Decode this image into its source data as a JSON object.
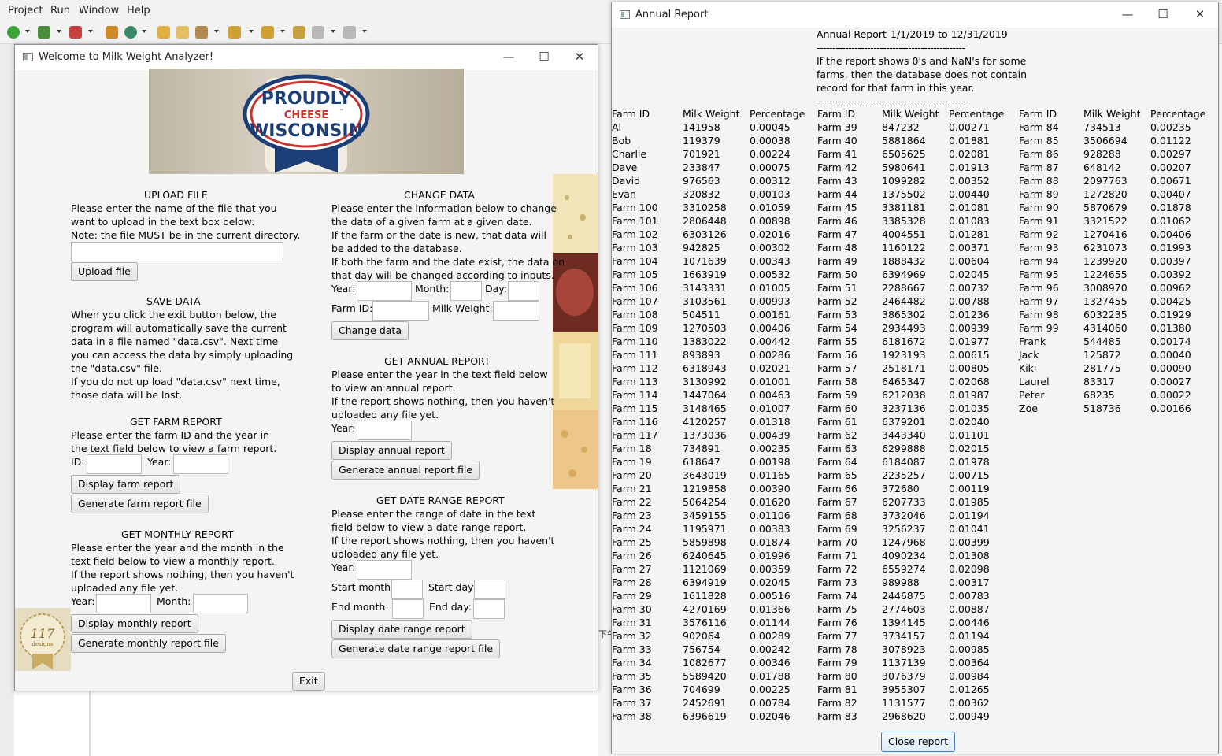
{
  "ide": {
    "menu": [
      "Project",
      "Run",
      "Window",
      "Help"
    ],
    "hint": "下午"
  },
  "main_window": {
    "title": "Welcome to Milk Weight Analyzer!",
    "controls": {
      "minimize": "—",
      "maximize": "☐",
      "close": "✕"
    },
    "banner": {
      "line1": "PROUDLY",
      "line2": "CHEESE",
      "line3": "WISCONSIN",
      "tm": "™"
    },
    "badge": {
      "number": "117",
      "text": "designs"
    },
    "upload": {
      "heading": "UPLOAD FILE",
      "lines": [
        "Please enter the name of the file that you",
        "want to upload in the text box below:",
        "Note: the file MUST be in the current directory."
      ],
      "button": "Upload file"
    },
    "save": {
      "heading": "SAVE DATA",
      "lines": [
        "When you click the exit button below, the",
        "program will automatically save the current",
        "data in a file named \"data.csv\". Next time",
        "you can access the data by simply uploading",
        "the \"data.csv\" file.",
        "If you do not up load \"data.csv\" next time,",
        "those data will be lost."
      ]
    },
    "farm_report": {
      "heading": "GET FARM REPORT",
      "lines": [
        "Please enter the farm ID and the year in",
        "the text field below to view a farm report."
      ],
      "id_label": "ID:",
      "year_label": "Year:",
      "display_button": "Display farm report",
      "generate_button": "Generate farm report file"
    },
    "monthly_report": {
      "heading": "GET MONTHLY REPORT",
      "lines": [
        "Please enter the year and the month in the",
        "text field below to view a monthly report.",
        "If the report shows nothing, then you haven't",
        "uploaded any file yet."
      ],
      "year_label": "Year:",
      "month_label": "Month:",
      "display_button": "Display monthly report",
      "generate_button": "Generate monthly report file"
    },
    "change_data": {
      "heading": "CHANGE DATA",
      "lines": [
        "Please enter the information below to change",
        "the data of a given farm at a given date.",
        "If the farm or the date is new, that data will",
        "be added to the database.",
        "If both the farm and the date exist, the data on",
        "that day will be changed according to inputs."
      ],
      "year_label": "Year:",
      "month_label": "Month:",
      "day_label": "Day:",
      "farm_id_label": "Farm ID:",
      "milk_weight_label": "Milk Weight:",
      "button": "Change data"
    },
    "annual_report": {
      "heading": "GET ANNUAL REPORT",
      "lines": [
        "Please enter the year in the text field below",
        "to view an annual report.",
        "If the report shows nothing, then you haven't",
        "uploaded any file yet."
      ],
      "year_label": "Year:",
      "display_button": "Display annual report",
      "generate_button": "Generate annual report file"
    },
    "date_range_report": {
      "heading": "GET DATE RANGE REPORT",
      "lines": [
        "Please enter the range of date in the text",
        "field below to view a date range report.",
        "If the report shows nothing, then you haven't",
        "uploaded any file yet."
      ],
      "year_label": "Year:",
      "start_month_label": "Start month:",
      "start_day_label": "Start day:",
      "end_month_label": "End month:",
      "end_day_label": "End day:",
      "display_button": "Display date range report",
      "generate_button": "Generate date range report file"
    },
    "exit_button": "Exit"
  },
  "report_window": {
    "title": "Annual Report",
    "controls": {
      "minimize": "—",
      "maximize": "☐",
      "close": "✕"
    },
    "header_title": "Annual Report",
    "header_range": "1/1/2019 to 12/31/2019",
    "separator": "-----------------------------------------------",
    "note": [
      "If the report shows 0's and NaN's for some",
      "farms, then the database does not contain",
      "record for that farm in this year."
    ],
    "columns": [
      "Farm ID",
      "Milk Weight",
      "Percentage"
    ],
    "col1": [
      [
        "Al",
        "141958",
        "0.00045"
      ],
      [
        "Bob",
        "119379",
        "0.00038"
      ],
      [
        "Charlie",
        "701921",
        "0.00224"
      ],
      [
        "Dave",
        "233847",
        "0.00075"
      ],
      [
        "David",
        "976563",
        "0.00312"
      ],
      [
        "Evan",
        "320832",
        "0.00103"
      ],
      [
        "Farm 100",
        "3310258",
        "0.01059"
      ],
      [
        "Farm 101",
        "2806448",
        "0.00898"
      ],
      [
        "Farm 102",
        "6303126",
        "0.02016"
      ],
      [
        "Farm 103",
        "942825",
        "0.00302"
      ],
      [
        "Farm 104",
        "1071639",
        "0.00343"
      ],
      [
        "Farm 105",
        "1663919",
        "0.00532"
      ],
      [
        "Farm 106",
        "3143331",
        "0.01005"
      ],
      [
        "Farm 107",
        "3103561",
        "0.00993"
      ],
      [
        "Farm 108",
        "504511",
        "0.00161"
      ],
      [
        "Farm 109",
        "1270503",
        "0.00406"
      ],
      [
        "Farm 110",
        "1383022",
        "0.00442"
      ],
      [
        "Farm 111",
        "893893",
        "0.00286"
      ],
      [
        "Farm 112",
        "6318943",
        "0.02021"
      ],
      [
        "Farm 113",
        "3130992",
        "0.01001"
      ],
      [
        "Farm 114",
        "1447064",
        "0.00463"
      ],
      [
        "Farm 115",
        "3148465",
        "0.01007"
      ],
      [
        "Farm 116",
        "4120257",
        "0.01318"
      ],
      [
        "Farm 117",
        "1373036",
        "0.00439"
      ],
      [
        "Farm 18",
        "734891",
        "0.00235"
      ],
      [
        "Farm 19",
        "618647",
        "0.00198"
      ],
      [
        "Farm 20",
        "3643019",
        "0.01165"
      ],
      [
        "Farm 21",
        "1219858",
        "0.00390"
      ],
      [
        "Farm 22",
        "5064254",
        "0.01620"
      ],
      [
        "Farm 23",
        "3459155",
        "0.01106"
      ],
      [
        "Farm 24",
        "1195971",
        "0.00383"
      ],
      [
        "Farm 25",
        "5859898",
        "0.01874"
      ],
      [
        "Farm 26",
        "6240645",
        "0.01996"
      ],
      [
        "Farm 27",
        "1121069",
        "0.00359"
      ],
      [
        "Farm 28",
        "6394919",
        "0.02045"
      ],
      [
        "Farm 29",
        "1611828",
        "0.00516"
      ],
      [
        "Farm 30",
        "4270169",
        "0.01366"
      ],
      [
        "Farm 31",
        "3576116",
        "0.01144"
      ],
      [
        "Farm 32",
        "902064",
        "0.00289"
      ],
      [
        "Farm 33",
        "756754",
        "0.00242"
      ],
      [
        "Farm 34",
        "1082677",
        "0.00346"
      ],
      [
        "Farm 35",
        "5589420",
        "0.01788"
      ],
      [
        "Farm 36",
        "704699",
        "0.00225"
      ],
      [
        "Farm 37",
        "2452691",
        "0.00784"
      ],
      [
        "Farm 38",
        "6396619",
        "0.02046"
      ]
    ],
    "col2": [
      [
        "Farm 39",
        "847232",
        "0.00271"
      ],
      [
        "Farm 40",
        "5881864",
        "0.01881"
      ],
      [
        "Farm 41",
        "6505625",
        "0.02081"
      ],
      [
        "Farm 42",
        "5980641",
        "0.01913"
      ],
      [
        "Farm 43",
        "1099282",
        "0.00352"
      ],
      [
        "Farm 44",
        "1375502",
        "0.00440"
      ],
      [
        "Farm 45",
        "3381181",
        "0.01081"
      ],
      [
        "Farm 46",
        "3385328",
        "0.01083"
      ],
      [
        "Farm 47",
        "4004551",
        "0.01281"
      ],
      [
        "Farm 48",
        "1160122",
        "0.00371"
      ],
      [
        "Farm 49",
        "1888432",
        "0.00604"
      ],
      [
        "Farm 50",
        "6394969",
        "0.02045"
      ],
      [
        "Farm 51",
        "2288667",
        "0.00732"
      ],
      [
        "Farm 52",
        "2464482",
        "0.00788"
      ],
      [
        "Farm 53",
        "3865302",
        "0.01236"
      ],
      [
        "Farm 54",
        "2934493",
        "0.00939"
      ],
      [
        "Farm 55",
        "6181672",
        "0.01977"
      ],
      [
        "Farm 56",
        "1923193",
        "0.00615"
      ],
      [
        "Farm 57",
        "2518171",
        "0.00805"
      ],
      [
        "Farm 58",
        "6465347",
        "0.02068"
      ],
      [
        "Farm 59",
        "6212038",
        "0.01987"
      ],
      [
        "Farm 60",
        "3237136",
        "0.01035"
      ],
      [
        "Farm 61",
        "6379201",
        "0.02040"
      ],
      [
        "Farm 62",
        "3443340",
        "0.01101"
      ],
      [
        "Farm 63",
        "6299888",
        "0.02015"
      ],
      [
        "Farm 64",
        "6184087",
        "0.01978"
      ],
      [
        "Farm 65",
        "2235257",
        "0.00715"
      ],
      [
        "Farm 66",
        "372680",
        "0.00119"
      ],
      [
        "Farm 67",
        "6207733",
        "0.01985"
      ],
      [
        "Farm 68",
        "3732046",
        "0.01194"
      ],
      [
        "Farm 69",
        "3256237",
        "0.01041"
      ],
      [
        "Farm 70",
        "1247968",
        "0.00399"
      ],
      [
        "Farm 71",
        "4090234",
        "0.01308"
      ],
      [
        "Farm 72",
        "6559274",
        "0.02098"
      ],
      [
        "Farm 73",
        "989988",
        "0.00317"
      ],
      [
        "Farm 74",
        "2446875",
        "0.00783"
      ],
      [
        "Farm 75",
        "2774603",
        "0.00887"
      ],
      [
        "Farm 76",
        "1394145",
        "0.00446"
      ],
      [
        "Farm 77",
        "3734157",
        "0.01194"
      ],
      [
        "Farm 78",
        "3078923",
        "0.00985"
      ],
      [
        "Farm 79",
        "1137139",
        "0.00364"
      ],
      [
        "Farm 80",
        "3076379",
        "0.00984"
      ],
      [
        "Farm 81",
        "3955307",
        "0.01265"
      ],
      [
        "Farm 82",
        "1131577",
        "0.00362"
      ],
      [
        "Farm 83",
        "2968620",
        "0.00949"
      ]
    ],
    "col3": [
      [
        "Farm 84",
        "734513",
        "0.00235"
      ],
      [
        "Farm 85",
        "3506694",
        "0.01122"
      ],
      [
        "Farm 86",
        "928288",
        "0.00297"
      ],
      [
        "Farm 87",
        "648142",
        "0.00207"
      ],
      [
        "Farm 88",
        "2097763",
        "0.00671"
      ],
      [
        "Farm 89",
        "1272820",
        "0.00407"
      ],
      [
        "Farm 90",
        "5870679",
        "0.01878"
      ],
      [
        "Farm 91",
        "3321522",
        "0.01062"
      ],
      [
        "Farm 92",
        "1270416",
        "0.00406"
      ],
      [
        "Farm 93",
        "6231073",
        "0.01993"
      ],
      [
        "Farm 94",
        "1239920",
        "0.00397"
      ],
      [
        "Farm 95",
        "1224655",
        "0.00392"
      ],
      [
        "Farm 96",
        "3008970",
        "0.00962"
      ],
      [
        "Farm 97",
        "1327455",
        "0.00425"
      ],
      [
        "Farm 98",
        "6032235",
        "0.01929"
      ],
      [
        "Farm 99",
        "4314060",
        "0.01380"
      ],
      [
        "Frank",
        "544485",
        "0.00174"
      ],
      [
        "Jack",
        "125872",
        "0.00040"
      ],
      [
        "Kiki",
        "281775",
        "0.00090"
      ],
      [
        "Laurel",
        "83317",
        "0.00027"
      ],
      [
        "Peter",
        "68235",
        "0.00022"
      ],
      [
        "Zoe",
        "518736",
        "0.00166"
      ]
    ],
    "close_button": "Close report"
  }
}
